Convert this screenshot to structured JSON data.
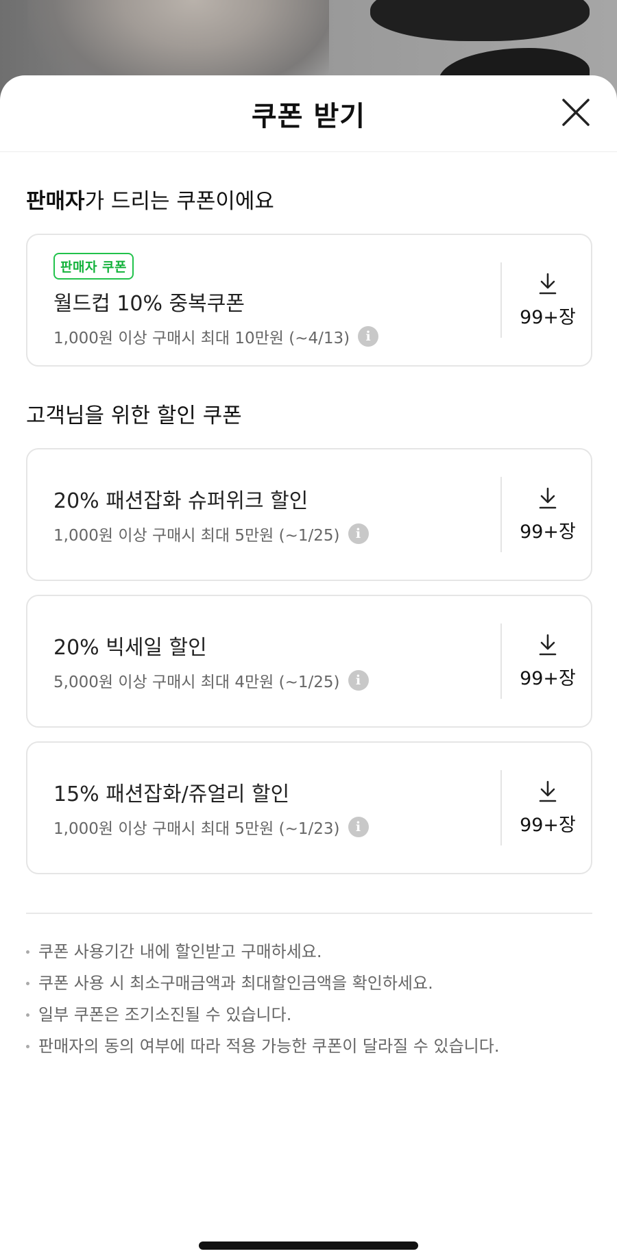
{
  "sheet": {
    "title": "쿠폰 받기"
  },
  "seller_section": {
    "title_bold": "판매자",
    "title_rest": "가 드리는 쿠폰이에요",
    "coupons": [
      {
        "tag": "판매자 쿠폰",
        "name": "월드컵 10% 중복쿠폰",
        "condition": "1,000원 이상 구매시 최대 10만원 (~4/13)",
        "count": "99+장"
      }
    ]
  },
  "customer_section": {
    "title": "고객님을 위한 할인 쿠폰",
    "coupons": [
      {
        "name": "20% 패션잡화 슈퍼위크 할인",
        "condition": "1,000원 이상 구매시 최대 5만원 (~1/25)",
        "count": "99+장"
      },
      {
        "name": "20% 빅세일 할인",
        "condition": "5,000원 이상 구매시 최대 4만원 (~1/25)",
        "count": "99+장"
      },
      {
        "name": "15% 패션잡화/쥬얼리 할인",
        "condition": "1,000원 이상 구매시 최대 5만원 (~1/23)",
        "count": "99+장"
      }
    ]
  },
  "notes": [
    "쿠폰 사용기간 내에 할인받고 구매하세요.",
    "쿠폰 사용 시 최소구매금액과 최대할인금액을 확인하세요.",
    "일부 쿠폰은 조기소진될 수 있습니다.",
    "판매자의 동의 여부에 따라 적용 가능한 쿠폰이 달라질 수 있습니다."
  ],
  "icons": {
    "close": "close-icon",
    "download": "download-icon",
    "info": "info-icon"
  },
  "colors": {
    "seller_tag": "#13b23b",
    "sheet_bg": "#ffffff",
    "dim_bg": "#8a8a8a"
  }
}
